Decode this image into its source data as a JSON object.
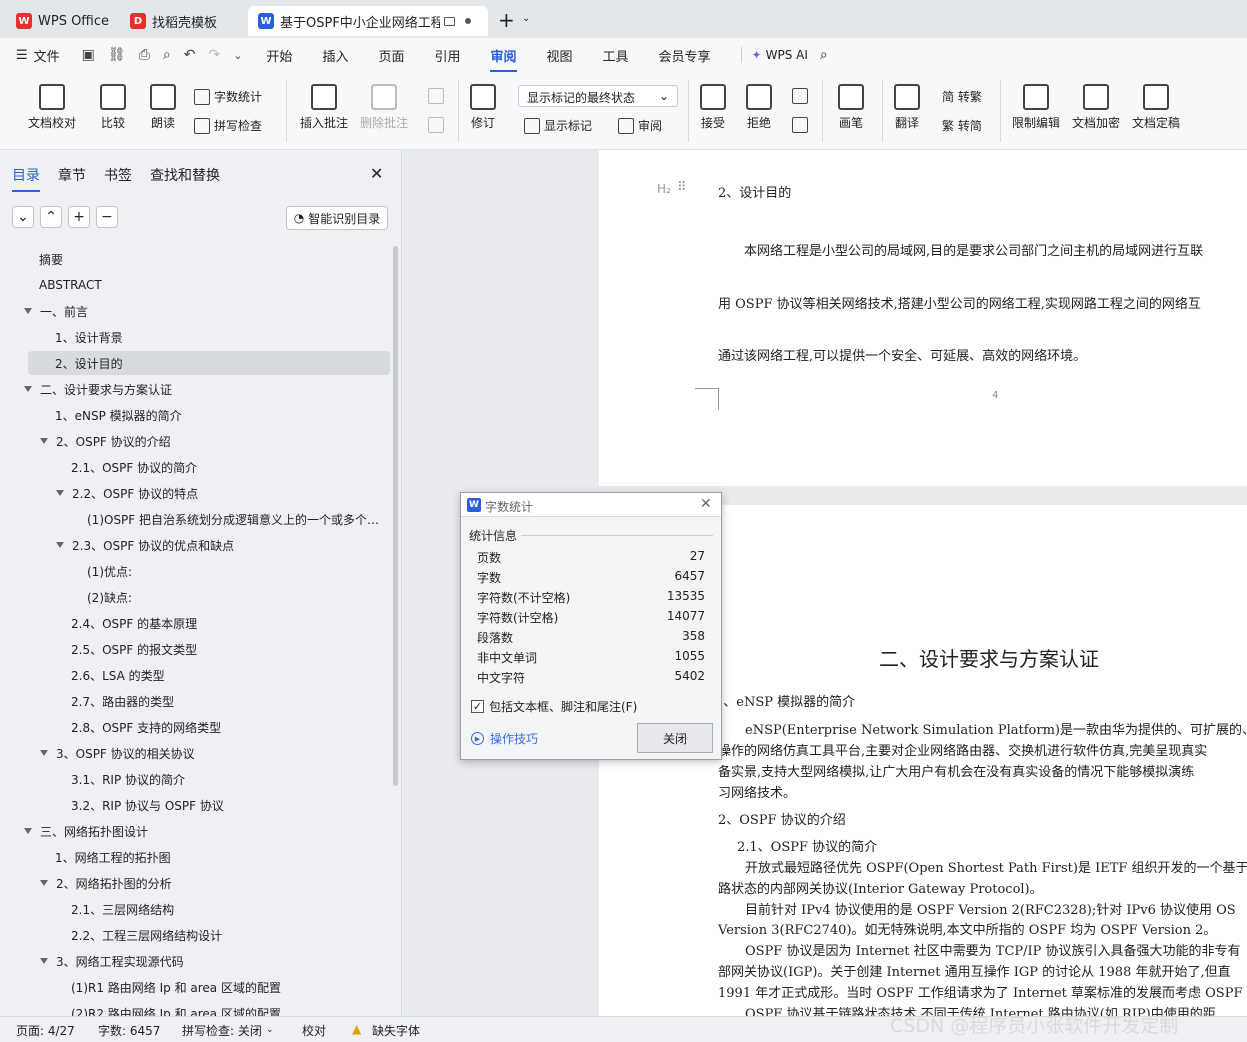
{
  "tabs": [
    {
      "label": "WPS Office",
      "icon": "wps-logo-icon"
    },
    {
      "label": "找稻壳模板",
      "icon": "docer-icon"
    },
    {
      "label": "基于OSPF中小企业网络工程的",
      "icon": "word-doc-icon"
    }
  ],
  "menu": {
    "file": "文件",
    "items": [
      "开始",
      "插入",
      "页面",
      "引用",
      "审阅",
      "视图",
      "工具",
      "会员专享"
    ],
    "active": "审阅",
    "ai": "WPS AI"
  },
  "ribbon": {
    "proof": "文档校对",
    "compare": "比较",
    "read": "朗读",
    "wordcount": "字数统计",
    "spell": "拼写检查",
    "insert_comment": "插入批注",
    "delete_comment": "删除批注",
    "revise": "修订",
    "markup_state": "显示标记的最终状态",
    "show_markup": "显示标记",
    "review_pane": "审阅",
    "accept": "接受",
    "reject": "拒绝",
    "ink": "画笔",
    "translate": "翻译",
    "to_trad": "简 转繁",
    "to_simp": "繁 转简",
    "restrict": "限制编辑",
    "encrypt": "文档加密",
    "finalize": "文档定稿"
  },
  "sidebar": {
    "tabs": [
      "目录",
      "章节",
      "书签",
      "查找和替换"
    ],
    "smart_toc": "智能识别目录",
    "toc": [
      {
        "text": "摘要",
        "level": 1,
        "arrow": false
      },
      {
        "text": "ABSTRACT",
        "level": 1,
        "arrow": false
      },
      {
        "text": "一、前言",
        "level": 1,
        "arrow": true
      },
      {
        "text": "1、设计背景",
        "level": 2,
        "arrow": false
      },
      {
        "text": "2、设计目的",
        "level": 2,
        "arrow": false,
        "selected": true
      },
      {
        "text": "二、设计要求与方案认证",
        "level": 1,
        "arrow": true
      },
      {
        "text": "1、eNSP 模拟器的简介",
        "level": 2,
        "arrow": false
      },
      {
        "text": "2、OSPF 协议的介绍",
        "level": 2,
        "arrow": true
      },
      {
        "text": "2.1、OSPF 协议的简介",
        "level": 3,
        "arrow": false
      },
      {
        "text": "2.2、OSPF 协议的特点",
        "level": 3,
        "arrow": true
      },
      {
        "text": "(1)OSPF 把自治系统划分成逻辑意义上的一个或多个…",
        "level": 4,
        "arrow": false
      },
      {
        "text": "2.3、OSPF 协议的优点和缺点",
        "level": 3,
        "arrow": true
      },
      {
        "text": "(1)优点:",
        "level": 4,
        "arrow": false
      },
      {
        "text": "(2)缺点:",
        "level": 4,
        "arrow": false
      },
      {
        "text": "2.4、OSPF 的基本原理",
        "level": 3,
        "arrow": false
      },
      {
        "text": "2.5、OSPF 的报文类型",
        "level": 3,
        "arrow": false
      },
      {
        "text": "2.6、LSA 的类型",
        "level": 3,
        "arrow": false
      },
      {
        "text": "2.7、路由器的类型",
        "level": 3,
        "arrow": false
      },
      {
        "text": "2.8、OSPF 支持的网络类型",
        "level": 3,
        "arrow": false
      },
      {
        "text": "3、OSPF 协议的相关协议",
        "level": 2,
        "arrow": true
      },
      {
        "text": "3.1、RIP 协议的简介",
        "level": 3,
        "arrow": false
      },
      {
        "text": "3.2、RIP 协议与 OSPF 协议",
        "level": 3,
        "arrow": false
      },
      {
        "text": "三、网络拓扑图设计",
        "level": 1,
        "arrow": true
      },
      {
        "text": "1、网络工程的拓扑图",
        "level": 2,
        "arrow": false
      },
      {
        "text": "2、网络拓扑图的分析",
        "level": 2,
        "arrow": true
      },
      {
        "text": "2.1、三层网络结构",
        "level": 3,
        "arrow": false
      },
      {
        "text": "2.2、工程三层网络结构设计",
        "level": 3,
        "arrow": false
      },
      {
        "text": "3、网络工程实现源代码",
        "level": 2,
        "arrow": true
      },
      {
        "text": "(1)R1 路由网络 Ip 和 area 区域的配置",
        "level": 3,
        "arrow": false
      },
      {
        "text": "(2)R2 路由网络 Ip 和 area 区域的配置",
        "level": 3,
        "arrow": false
      }
    ]
  },
  "doc": {
    "page1": {
      "heading_marker": "H₂",
      "heading": "2、设计目的",
      "lines": [
        "本网络工程是小型公司的局域网,目的是要求公司部门之间主机的局域网进行互联",
        "用 OSPF 协议等相关网络技术,搭建小型公司的网络工程,实现网路工程之间的网络互",
        "通过该网络工程,可以提供一个安全、可延展、高效的网络环境。"
      ],
      "page_number": "4"
    },
    "page2": {
      "chapter_title": "二、设计要求与方案认证",
      "h_ensp": "1、eNSP 模拟器的简介",
      "ensp_lines": [
        "eNSP(Enterprise Network Simulation Platform)是一款由华为提供的、可扩展的、图形",
        "操作的网络仿真工具平台,主要对企业网络路由器、交换机进行软件仿真,完美呈现真实",
        "备实景,支持大型网络模拟,让广大用户有机会在没有真实设备的情况下能够模拟演练",
        "习网络技术。"
      ],
      "h_ospf": "2、OSPF 协议的介绍",
      "h_ospf_intro": "2.1、OSPF 协议的简介",
      "ospf_lines": [
        "开放式最短路径优先 OSPF(Open Shortest Path First)是 IETF 组织开发的一个基于",
        "路状态的内部网关协议(Interior Gateway Protocol)。",
        "目前针对 IPv4 协议使用的是 OSPF Version 2(RFC2328);针对 IPv6 协议使用 OS",
        "Version 3(RFC2740)。如无特殊说明,本文中所指的 OSPF 均为 OSPF Version 2。",
        "OSPF 协议是因为  Internet 社区中需要为 TCP/IP 协议族引入具备强大功能的非专有",
        "部网关协议(IGP)。关于创建 Internet 通用互操作 IGP 的讨论从 1988 年就开始了,但直",
        "1991 年才正式成形。当时 OSPF 工作组请求为了 Internet 草案标准的发展而考虑 OSPF",
        "OSPF 协议基于链路状态技术,不同于传统 Internet 路由协议(如 RIP)中使用的距"
      ]
    }
  },
  "dialog": {
    "title": "字数统计",
    "section": "统计信息",
    "rows": [
      {
        "label": "页数",
        "value": "27"
      },
      {
        "label": "字数",
        "value": "6457"
      },
      {
        "label": "字符数(不计空格)",
        "value": "13535"
      },
      {
        "label": "字符数(计空格)",
        "value": "14077"
      },
      {
        "label": "段落数",
        "value": "358"
      },
      {
        "label": "非中文单词",
        "value": "1055"
      },
      {
        "label": "中文字符",
        "value": "5402"
      }
    ],
    "checkbox": "包括文本框、脚注和尾注(F)",
    "checkbox_checked": true,
    "tips": "操作技巧",
    "close": "关闭"
  },
  "status": {
    "page": "页面: 4/27",
    "words": "字数: 6457",
    "spell": "拼写检查: 关闭",
    "proof": "校对",
    "missing_font": "缺失字体"
  },
  "watermark": "CSDN @程序员小张软件开发定制"
}
